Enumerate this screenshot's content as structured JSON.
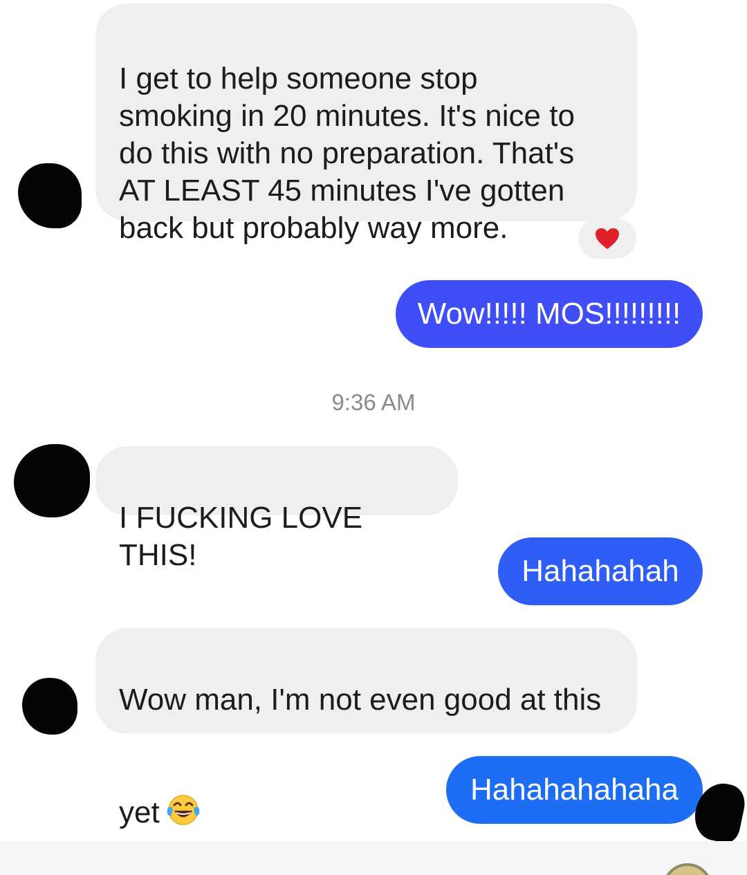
{
  "messages": [
    {
      "sender": "contact",
      "text": "I get to help someone stop\nsmoking in 20 minutes. It's nice to\ndo this with no preparation. That's\nAT LEAST 45 minutes I've gotten\nback but probably way more.",
      "reaction": "heart"
    },
    {
      "sender": "me",
      "text": "Wow!!!!! MOS!!!!!!!!!",
      "bubble_color": "#3F4EF7"
    },
    {
      "sender": "contact",
      "text": "I FUCKING LOVE THIS!"
    },
    {
      "sender": "me",
      "text": "Hahahahah",
      "bubble_color": "#2E5EF6"
    },
    {
      "sender": "contact",
      "text_line1": "Wow man, I'm not even good at this",
      "text_line2": "yet",
      "emoji": "face-with-tears-of-joy"
    },
    {
      "sender": "me",
      "text": "Hahahahahaha",
      "bubble_color": "#1E6DF5"
    }
  ],
  "timestamp": "9:36 AM",
  "colors": {
    "incoming_bubble": "#EFEFEF",
    "incoming_text": "#1C1C1C",
    "outgoing_text": "#FFFFFF",
    "timestamp_text": "#8A8A8A",
    "reaction_heart": "#E0202A"
  }
}
